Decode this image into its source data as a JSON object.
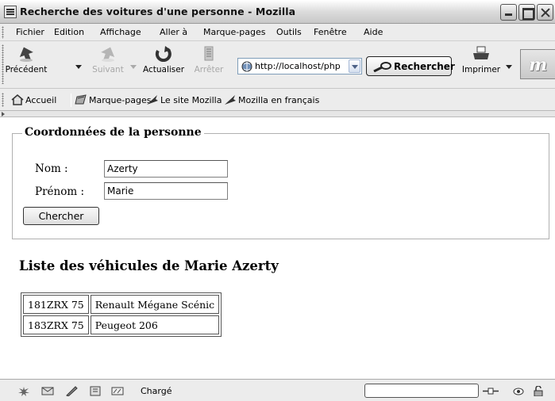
{
  "window": {
    "title": "Recherche des voitures d'une personne - Mozilla"
  },
  "menu": [
    "Fichier",
    "Edition",
    "Affichage",
    "Aller à",
    "Marque-pages",
    "Outils",
    "Fenêtre",
    "Aide"
  ],
  "nav": {
    "back": "Précédent",
    "forward": "Suivant",
    "reload": "Actualiser",
    "stop": "Arrêter",
    "url": "http://localhost/php",
    "search": "Rechercher",
    "print": "Imprimer"
  },
  "bookmarks": [
    "Accueil",
    "Marque-pages",
    "Le site Mozilla",
    "Mozilla en français"
  ],
  "form": {
    "legend": "Coordonnées de la personne",
    "nom_label": "Nom :",
    "nom_value": "Azerty",
    "prenom_label": "Prénom :",
    "prenom_value": "Marie",
    "submit": "Chercher"
  },
  "list": {
    "title": "Liste des véhicules de Marie Azerty",
    "rows": [
      [
        "181ZRX 75",
        "Renault Mégane Scénic"
      ],
      [
        "183ZRX 75",
        "Peugeot 206"
      ]
    ]
  },
  "status": {
    "text": "Chargé"
  }
}
